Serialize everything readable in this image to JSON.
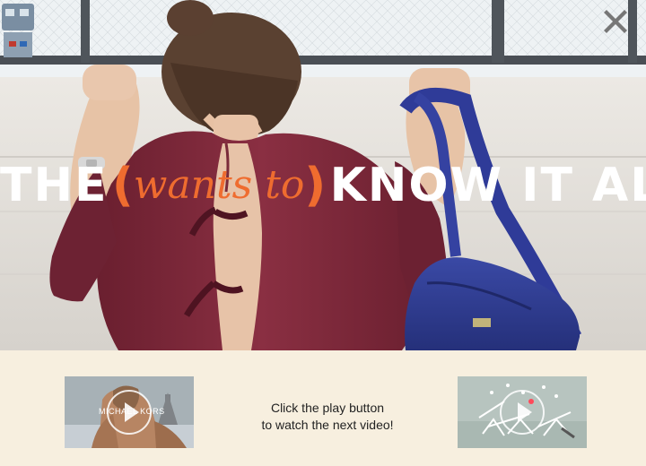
{
  "overlay": {
    "close_icon": "close-icon",
    "title": {
      "before": "THE",
      "open_paren": "(",
      "accent": "wants to",
      "close_paren": ")",
      "after": "KNOW IT ALL"
    },
    "colors": {
      "accent": "#ef6c2f",
      "panel_background": "#f7efdf",
      "title_white": "#ffffff"
    }
  },
  "video_nav": {
    "previous_thumbnail": {
      "brand_text": "MICHAEL KORS",
      "icon": "play-icon"
    },
    "message_line1": "Click the play button",
    "message_line2": "to watch the next video!",
    "next_thumbnail": {
      "icon": "play-icon"
    }
  }
}
